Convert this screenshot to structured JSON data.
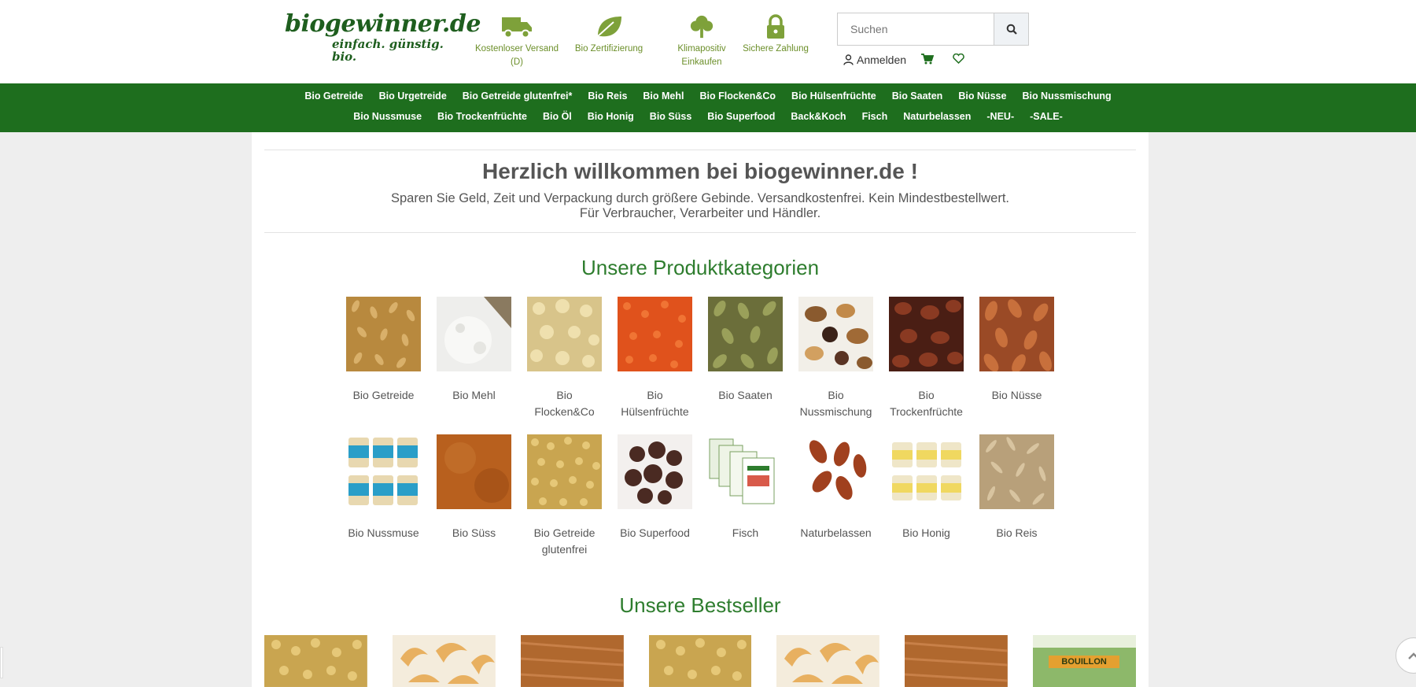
{
  "logo": {
    "main": "biogewinner.de",
    "tagline": "einfach. günstig. bio."
  },
  "usps": [
    {
      "icon": "truck-icon",
      "label": "Kostenloser Versand (D)"
    },
    {
      "icon": "leaf-icon",
      "label": "Bio Zertifizierung"
    },
    {
      "icon": "tree-icon",
      "label": "Klimapositiv Einkaufen"
    },
    {
      "icon": "lock-icon",
      "label": "Sichere Zahlung"
    }
  ],
  "search": {
    "placeholder": "Suchen"
  },
  "account": {
    "login_label": "Anmelden"
  },
  "nav": {
    "row1": [
      "Bio Getreide",
      "Bio Urgetreide",
      "Bio Getreide glutenfrei*",
      "Bio Reis",
      "Bio Mehl",
      "Bio Flocken&Co",
      "Bio Hülsenfrüchte",
      "Bio Saaten",
      "Bio Nüsse",
      "Bio Nussmischung"
    ],
    "row2": [
      "Bio Nussmuse",
      "Bio Trockenfrüchte",
      "Bio Öl",
      "Bio Honig",
      "Bio Süss",
      "Bio Superfood",
      "Back&Koch",
      "Fisch",
      "Naturbelassen",
      "-NEU-",
      "-SALE-"
    ]
  },
  "welcome": {
    "title": "Herzlich willkommen bei biogewinner.de !",
    "line1": "Sparen Sie Geld, Zeit und Verpackung durch größere Gebinde. Versandkostenfrei. Kein Mindestbestellwert.",
    "line2": "Für Verbraucher, Verarbeiter und Händler."
  },
  "categories": {
    "title": "Unsere Produktkategorien",
    "row1": [
      "Bio Getreide",
      "Bio Mehl",
      "Bio Flocken&Co",
      "Bio Hülsenfrüchte",
      "Bio Saaten",
      "Bio Nussmischung",
      "Bio Trockenfrüchte",
      "Bio Nüsse"
    ],
    "row2": [
      "Bio Nussmuse",
      "Bio Süss",
      "Bio Getreide glutenfrei",
      "Bio Superfood",
      "Fisch",
      "Naturbelassen",
      "Bio Honig",
      "Bio Reis"
    ]
  },
  "bestseller": {
    "title": "Unsere Bestseller",
    "bouillon_label": "BOUILLON"
  },
  "colors": {
    "brand_green": "#1e6e1e",
    "accent_green": "#6c8f2a",
    "title_green": "#2e7d2e"
  }
}
